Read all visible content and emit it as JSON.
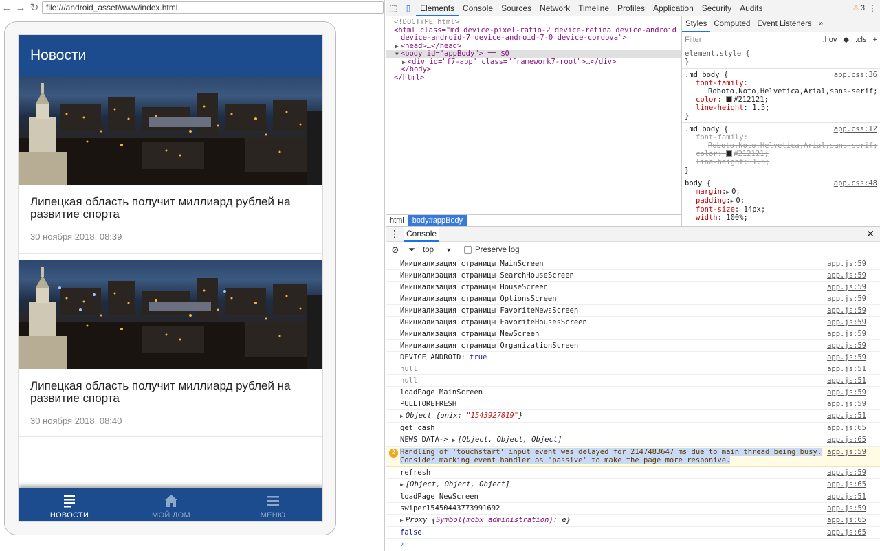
{
  "browser": {
    "url": "file:///android_asset/www/index.html"
  },
  "app": {
    "title": "Новости",
    "news": [
      {
        "title": "Липецкая область получит миллиард рублей на развитие спорта",
        "date": "30 ноября 2018, 08:39"
      },
      {
        "title": "Липецкая область получит миллиард рублей на развитие спорта",
        "date": "30 ноября 2018, 08:40"
      }
    ],
    "tabs": [
      {
        "label": "НОВОСТИ",
        "icon": "news-list-icon"
      },
      {
        "label": "МОЙ ДОМ",
        "icon": "home-icon"
      },
      {
        "label": "МЕНЮ",
        "icon": "menu-icon"
      }
    ]
  },
  "devtools": {
    "tabs": [
      "Elements",
      "Console",
      "Sources",
      "Network",
      "Timeline",
      "Profiles",
      "Application",
      "Security",
      "Audits"
    ],
    "warning_count": "3",
    "elements": {
      "doctype": "<!DOCTYPE html>",
      "html_open": "<html class=\"md device-pixel-ratio-2 device-retina device-android device-android-7 device-android-7-0 device-cordova\">",
      "head": "<head>…</head>",
      "body": "<body id=\"appBody\"> == $0",
      "div": "<div id=\"f7-app\" class=\"framework7-root\">…</div>",
      "body_close": "</body>",
      "html_close": "</html>"
    },
    "breadcrumbs": [
      "html",
      "body#appBody"
    ],
    "styles": {
      "tabs": [
        "Styles",
        "Computed",
        "Event Listeners"
      ],
      "filter_placeholder": "Filter",
      "hov": ":hov",
      "cls": ".cls",
      "element_style": "element.style {",
      "close_brace": "}",
      "rules": [
        {
          "selector": ".md body {",
          "source": "app.css:36",
          "props": [
            {
              "name": "font-family",
              "value": "Roboto,Noto,Helvetica,Arial,sans-serif;"
            },
            {
              "name": "color",
              "value": "#212121;"
            },
            {
              "name": "line-height",
              "value": "1.5;"
            }
          ]
        },
        {
          "selector": ".md body {",
          "source": "app.css:12",
          "props": [
            {
              "name": "font-family",
              "value": "Roboto,Noto,Helvetica,Arial,sans-serif;"
            },
            {
              "name": "color",
              "value": "#212121;"
            },
            {
              "name": "line-height",
              "value": "1.5;"
            }
          ]
        },
        {
          "selector": "body {",
          "source": "app.css:48",
          "props": [
            {
              "name": "margin",
              "value": "0;"
            },
            {
              "name": "padding",
              "value": "0;"
            },
            {
              "name": "font-size",
              "value": "14px;"
            },
            {
              "name": "width",
              "value": "100%;"
            }
          ]
        }
      ]
    },
    "console": {
      "tab": "Console",
      "context": "top",
      "preserve_log": "Preserve log",
      "logs": [
        {
          "text": "Инициализация страницы MainScreen",
          "src": "app.js:59"
        },
        {
          "text": "Инициализация страницы SearchHouseScreen",
          "src": "app.js:59"
        },
        {
          "text": "Инициализация страницы HouseScreen",
          "src": "app.js:59"
        },
        {
          "text": "Инициализация страницы OptionsScreen",
          "src": "app.js:59"
        },
        {
          "text": "Инициализация страницы FavoriteNewsScreen",
          "src": "app.js:59"
        },
        {
          "text": "Инициализация страницы FavoriteHousesScreen",
          "src": "app.js:59"
        },
        {
          "text": "Инициализация страницы NewScreen",
          "src": "app.js:59"
        },
        {
          "text": "Инициализация страницы OrganizationScreen",
          "src": "app.js:59"
        },
        {
          "text": "DEVICE ANDROID: ",
          "value": "true",
          "src": "app.js:59"
        },
        {
          "text": "null",
          "src": "app.js:51"
        },
        {
          "text": "null",
          "src": "app.js:51"
        },
        {
          "text": "loadPage MainScreen",
          "src": "app.js:59"
        },
        {
          "text": "PULLTOREFRESH",
          "src": "app.js:59"
        },
        {
          "text": "Object {unix: ",
          "value": "\"1543927819\"",
          "suffix": "}",
          "src": "app.js:51"
        },
        {
          "text": "get cash",
          "src": "app.js:65"
        },
        {
          "text": "NEWS DATA-> ",
          "value": "[Object, Object, Object]",
          "src": "app.js:65"
        },
        {
          "text": "Handling of 'touchstart' input event was delayed for 2147483647 ms due to main thread being busy.",
          "text2": "Consider marking event handler as 'passive' to make the page more responive.",
          "badge": "2",
          "src": "app.js:59"
        },
        {
          "text": "refresh",
          "src": "app.js:59"
        },
        {
          "text": "[Object, Object, Object]",
          "src": "app.js:65"
        },
        {
          "text": "loadPage NewScreen",
          "src": "app.js:51"
        },
        {
          "text": "swiper15450443773991692",
          "src": "app.js:59"
        },
        {
          "text": "Proxy {",
          "value": "Symbol(mobx administration)",
          "suffix": ": e}",
          "src": "app.js:65"
        },
        {
          "text": "false",
          "src": "app.js:65"
        }
      ],
      "prompt": "›"
    }
  }
}
